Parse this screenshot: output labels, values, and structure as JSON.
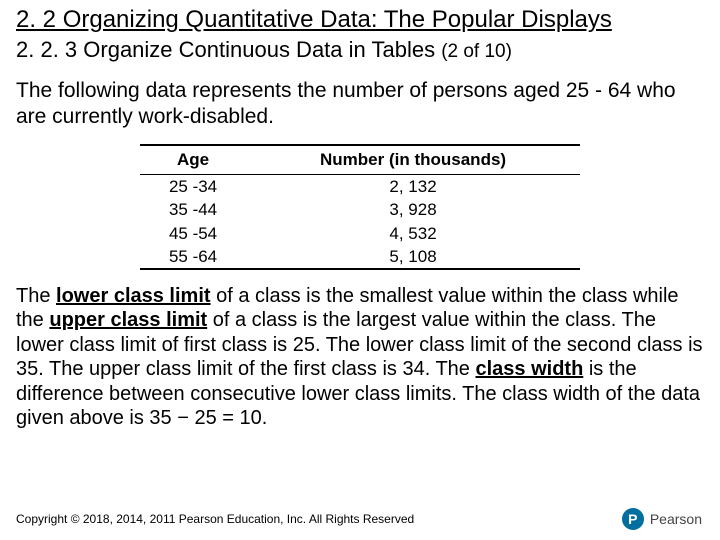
{
  "heading": {
    "section": "2. 2 Organizing Quantitative Data: The Popular Displays",
    "sub_prefix": "2. 2. 3 Organize Continuous Data in Tables ",
    "sub_suffix": "(2 of 10)"
  },
  "intro": "The following data represents the number of persons aged 25 - 64 who are currently work-disabled.",
  "chart_data": {
    "type": "table",
    "columns": [
      "Age",
      "Number (in thousands)"
    ],
    "rows": [
      {
        "age": "25 -34",
        "number": "2, 132"
      },
      {
        "age": "35 -44",
        "number": "3, 928"
      },
      {
        "age": "45 -54",
        "number": "4, 532"
      },
      {
        "age": "55 -64",
        "number": "5, 108"
      }
    ]
  },
  "body": {
    "seg1": "The ",
    "term1": "lower class limit",
    "seg2": " of a class is the smallest value within the class while the ",
    "term2": "upper class limit",
    "seg3": " of a class is the largest value within the class. The lower class limit of first class is 25. The lower class limit of the second class is 35. The upper class limit of the first class is 34. The ",
    "term3": "class width",
    "seg4": " is the difference between consecutive lower class limits. The class width of the data given above is 35 − 25 = 10."
  },
  "footer": {
    "copyright": "Copyright © 2018, 2014, 2011 Pearson Education, Inc. All Rights Reserved",
    "logo_mark": "P",
    "logo_text": "Pearson"
  }
}
